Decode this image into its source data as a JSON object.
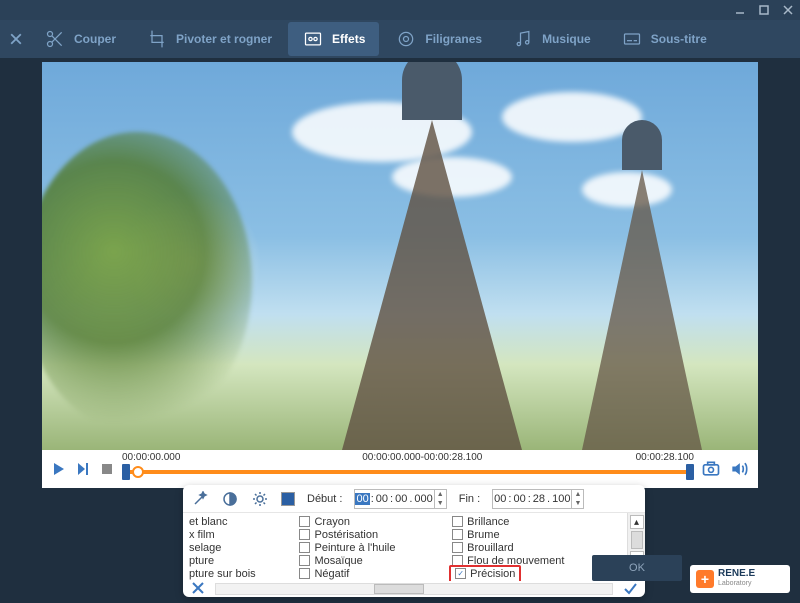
{
  "toolbar": {
    "tabs": [
      {
        "label": "Couper",
        "icon": "cut"
      },
      {
        "label": "Pivoter et rogner",
        "icon": "rotate"
      },
      {
        "label": "Effets",
        "icon": "effects",
        "active": true
      },
      {
        "label": "Filigranes",
        "icon": "watermark"
      },
      {
        "label": "Musique",
        "icon": "music"
      },
      {
        "label": "Sous-titre",
        "icon": "subtitle"
      }
    ]
  },
  "timeline": {
    "start_label": "00:00:00.000",
    "range_label": "00:00:00.000-00:00:28.100",
    "end_label": "00:00:28.100"
  },
  "panel": {
    "debut_label": "Début :",
    "fin_label": "Fin :",
    "debut_value": {
      "hh": "00",
      "mm": "00",
      "ss": "00",
      "ms": "000",
      "hl": "hh"
    },
    "fin_value": {
      "hh": "00",
      "mm": "00",
      "ss": "28",
      "ms": "100"
    },
    "col1": [
      "et blanc",
      "x film",
      "selage",
      "pture",
      "pture sur bois"
    ],
    "col2": [
      {
        "label": "Crayon",
        "checked": false
      },
      {
        "label": "Postérisation",
        "checked": false
      },
      {
        "label": "Peinture à l'huile",
        "checked": false
      },
      {
        "label": "Mosaïque",
        "checked": false
      },
      {
        "label": "Négatif",
        "checked": false
      }
    ],
    "col3": [
      {
        "label": "Brillance",
        "checked": false
      },
      {
        "label": "Brume",
        "checked": false
      },
      {
        "label": "Brouillard",
        "checked": false
      },
      {
        "label": "Flou de mouvement",
        "checked": false
      },
      {
        "label": "Précision",
        "checked": true,
        "highlight": true
      }
    ]
  },
  "ok_label": "OK",
  "logo": {
    "brand": "RENE.E",
    "sub": "Laboratory"
  }
}
